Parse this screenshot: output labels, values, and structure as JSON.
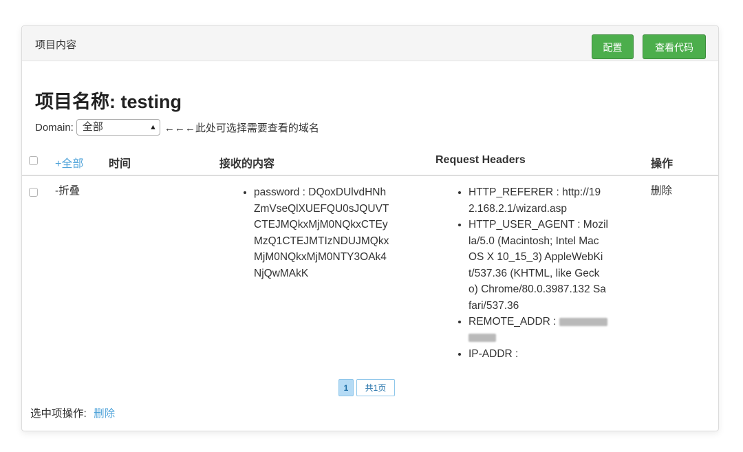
{
  "panel": {
    "title": "项目内容",
    "config_button": "配置",
    "view_code_button": "查看代码"
  },
  "project": {
    "title": "项目名称: testing"
  },
  "domain": {
    "label": "Domain:",
    "selected": "全部",
    "hint": "←←←此处可选择需要查看的域名"
  },
  "table": {
    "headers": {
      "all": "+全部",
      "time": "时间",
      "content": "接收的内容",
      "request_headers": "Request Headers",
      "actions": "操作"
    },
    "rows": [
      {
        "toggle": "-折叠",
        "time": "",
        "content": [
          "password : DQoxDUlvdHNhZmVseQlXUEFQU0sJQUVTCTEJMQkxMjM0NQkxCTEyMzQ1CTEJMTIzNDUJMQkxMjM0NQkxMjM0NTY3OAk4NjQwMAkK"
        ],
        "content_lines": [
          "password : DQoxDUlvdHNh",
          "ZmVseQlXUEFQU0sJQUVT",
          "CTEJMQkxMjM0NQkxCTEy",
          "MzQ1CTEJMTIzNDUJMQkx",
          "MjM0NQkxMjM0NTY3OAk4",
          "NjQwMAkK"
        ],
        "headers": [
          {
            "lines": [
              "HTTP_REFERER : http://19",
              "2.168.2.1/wizard.asp"
            ]
          },
          {
            "lines": [
              "HTTP_USER_AGENT : Mozil",
              "la/5.0 (Macintosh; Intel Mac",
              "OS X 10_15_3) AppleWebKi",
              "t/537.36 (KHTML, like Geck",
              "o) Chrome/80.0.3987.132 Sa",
              "fari/537.36"
            ]
          },
          {
            "lines": [
              "REMOTE_ADDR :"
            ]
          },
          {
            "lines": [
              "IP-ADDR :"
            ]
          }
        ],
        "delete": "删除"
      }
    ]
  },
  "pagination": {
    "current": "1",
    "total": "共1页"
  },
  "footer": {
    "label": "选中项操作:",
    "delete": "删除"
  }
}
